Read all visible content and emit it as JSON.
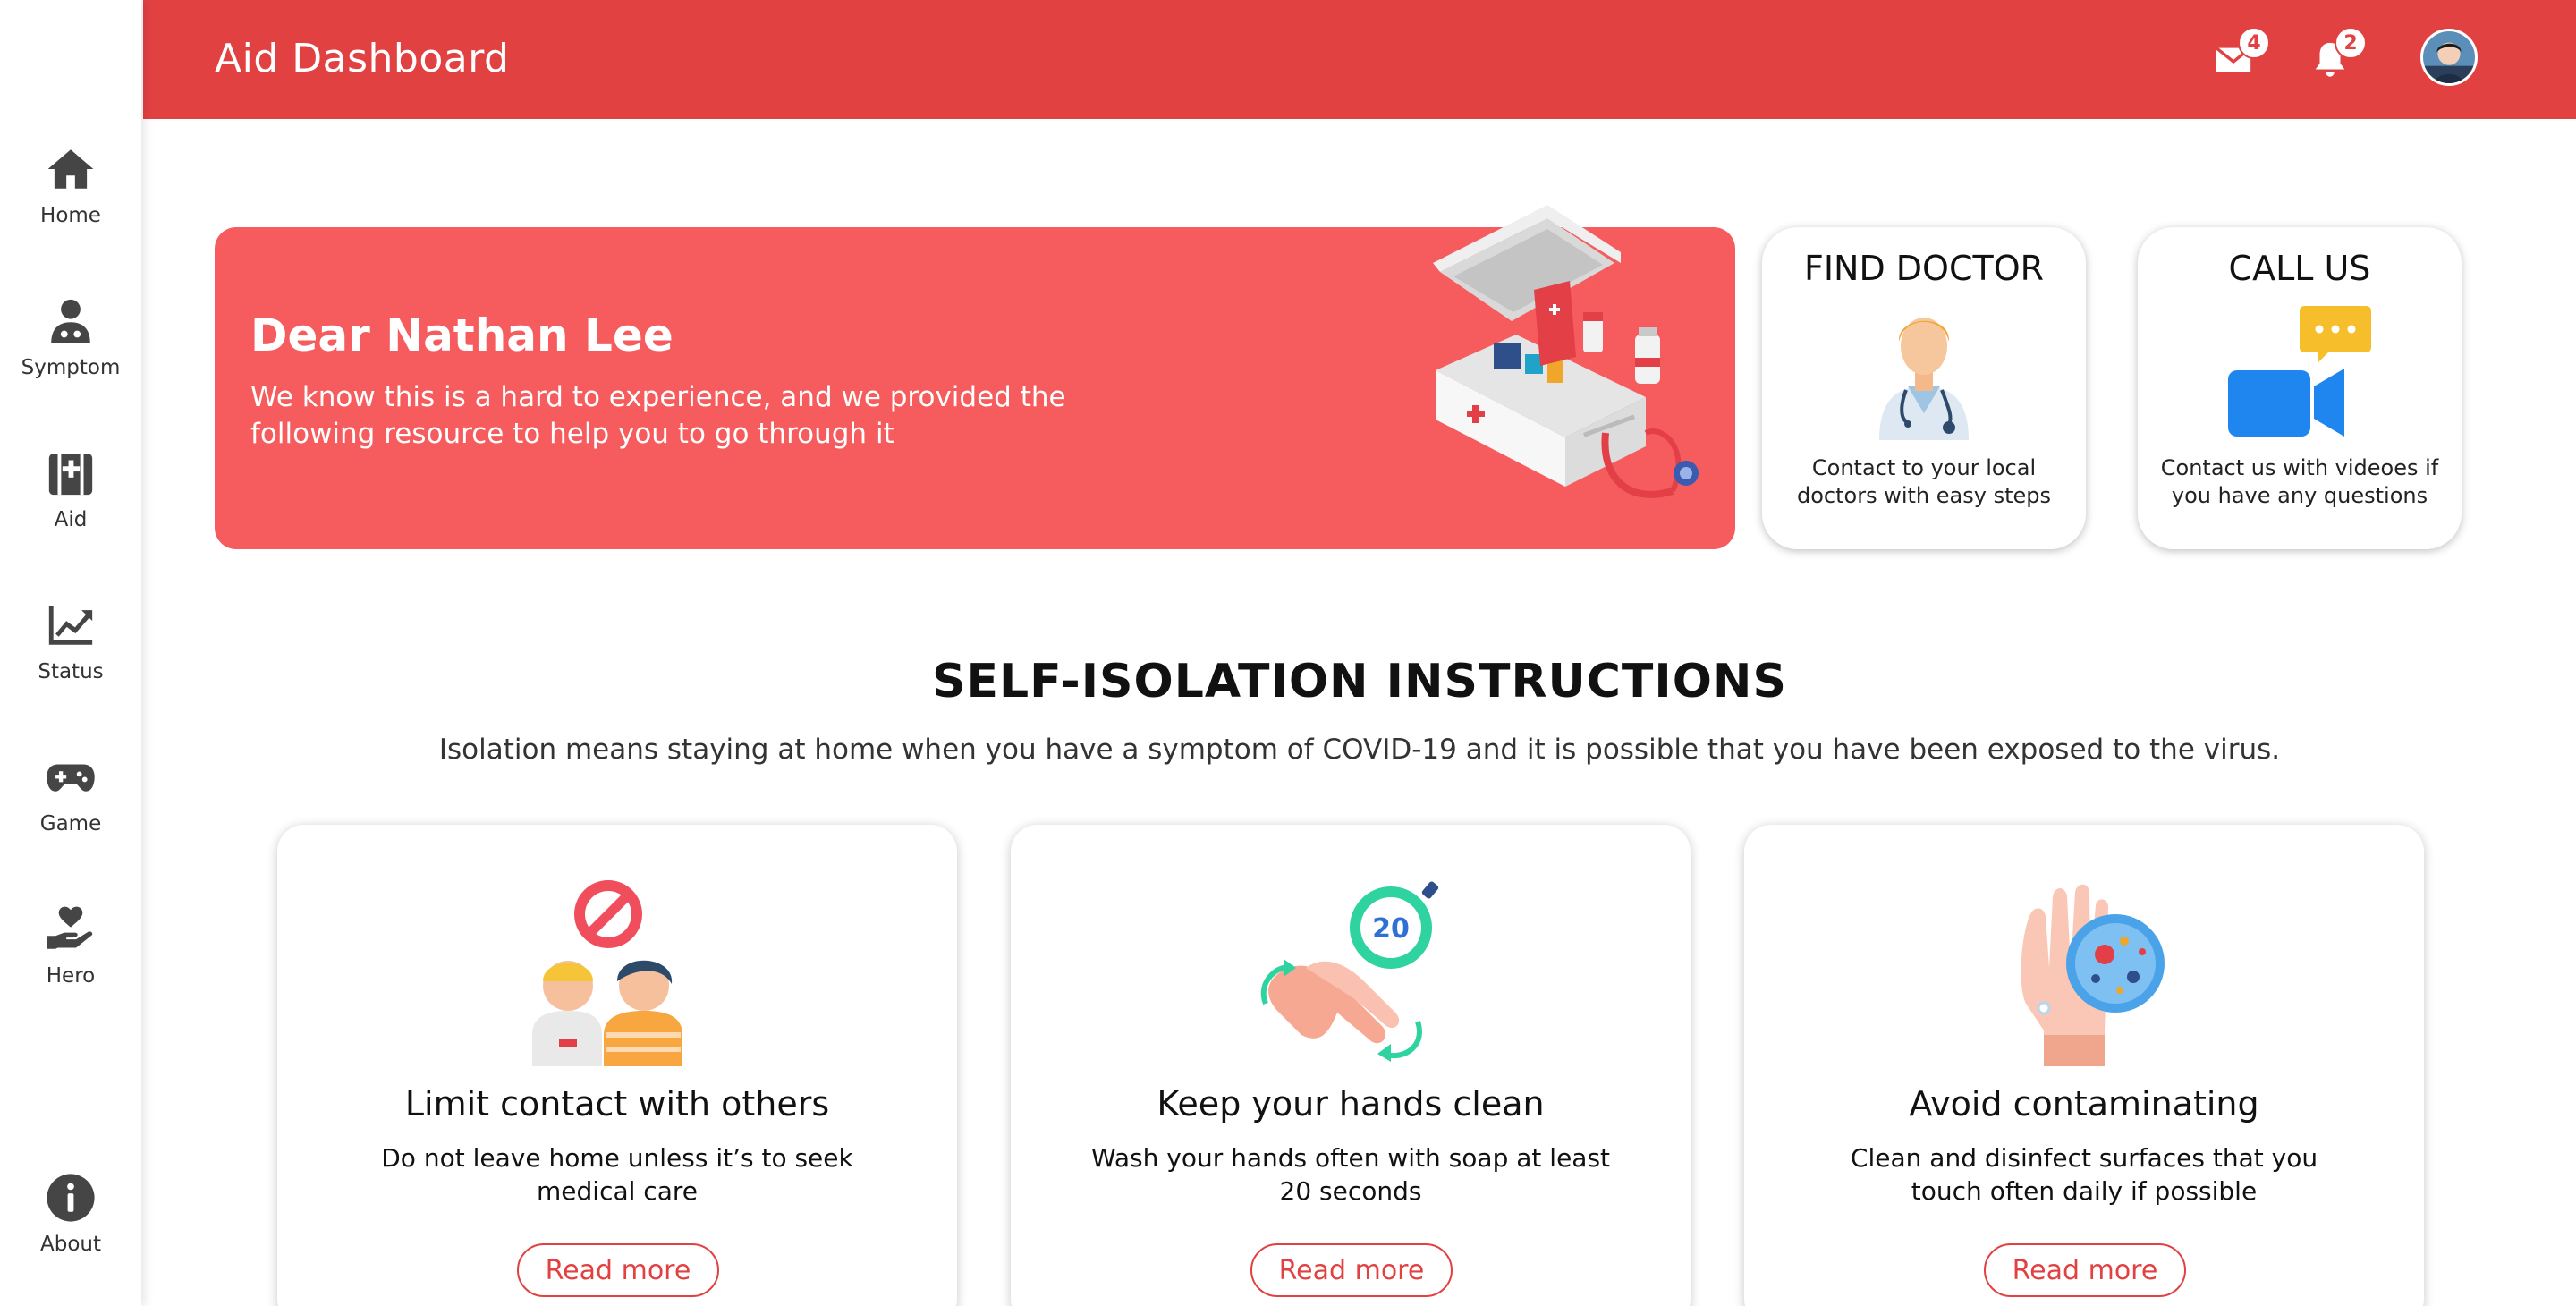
{
  "app": {
    "title": "Aid Dashboard"
  },
  "header": {
    "mail_count": "4",
    "notification_count": "2"
  },
  "sidebar": {
    "items": [
      {
        "label": "Home",
        "icon": "home-icon"
      },
      {
        "label": "Symptom",
        "icon": "doctor-icon"
      },
      {
        "label": "Aid",
        "icon": "first-aid-kit-icon"
      },
      {
        "label": "Status",
        "icon": "chart-line-icon"
      },
      {
        "label": "Game",
        "icon": "gamepad-icon"
      },
      {
        "label": "Hero",
        "icon": "heart-hand-icon"
      },
      {
        "label": "About",
        "icon": "info-icon"
      }
    ]
  },
  "banner": {
    "title": "Dear Nathan Lee",
    "text": "We know this is a hard to experience, and we provided the following resource to help you to go through it"
  },
  "cards": {
    "find_doctor": {
      "title": "FIND DOCTOR",
      "desc": "Contact to your local doctors with easy steps"
    },
    "call_us": {
      "title": "CALL US",
      "desc": "Contact us with videoes if you have any questions"
    }
  },
  "section": {
    "title": "SELF-ISOLATION INSTRUCTIONS",
    "subtitle": "Isolation means staying at home when you have a symptom of COVID-19 and it is possible that you have been exposed to the virus."
  },
  "instructions": [
    {
      "title": "Limit contact with others",
      "desc": "Do not leave home unless it’s to seek medical care",
      "button": "Read more"
    },
    {
      "title": "Keep your hands clean",
      "desc": "Wash your hands often with soap at least 20 seconds",
      "button": "Read more",
      "timer": "20"
    },
    {
      "title": "Avoid contaminating",
      "desc": "Clean and disinfect surfaces that you touch often daily if possible",
      "button": "Read more"
    }
  ],
  "colors": {
    "header": "#e24142",
    "banner": "#f65c5d",
    "accent": "#e24142"
  }
}
